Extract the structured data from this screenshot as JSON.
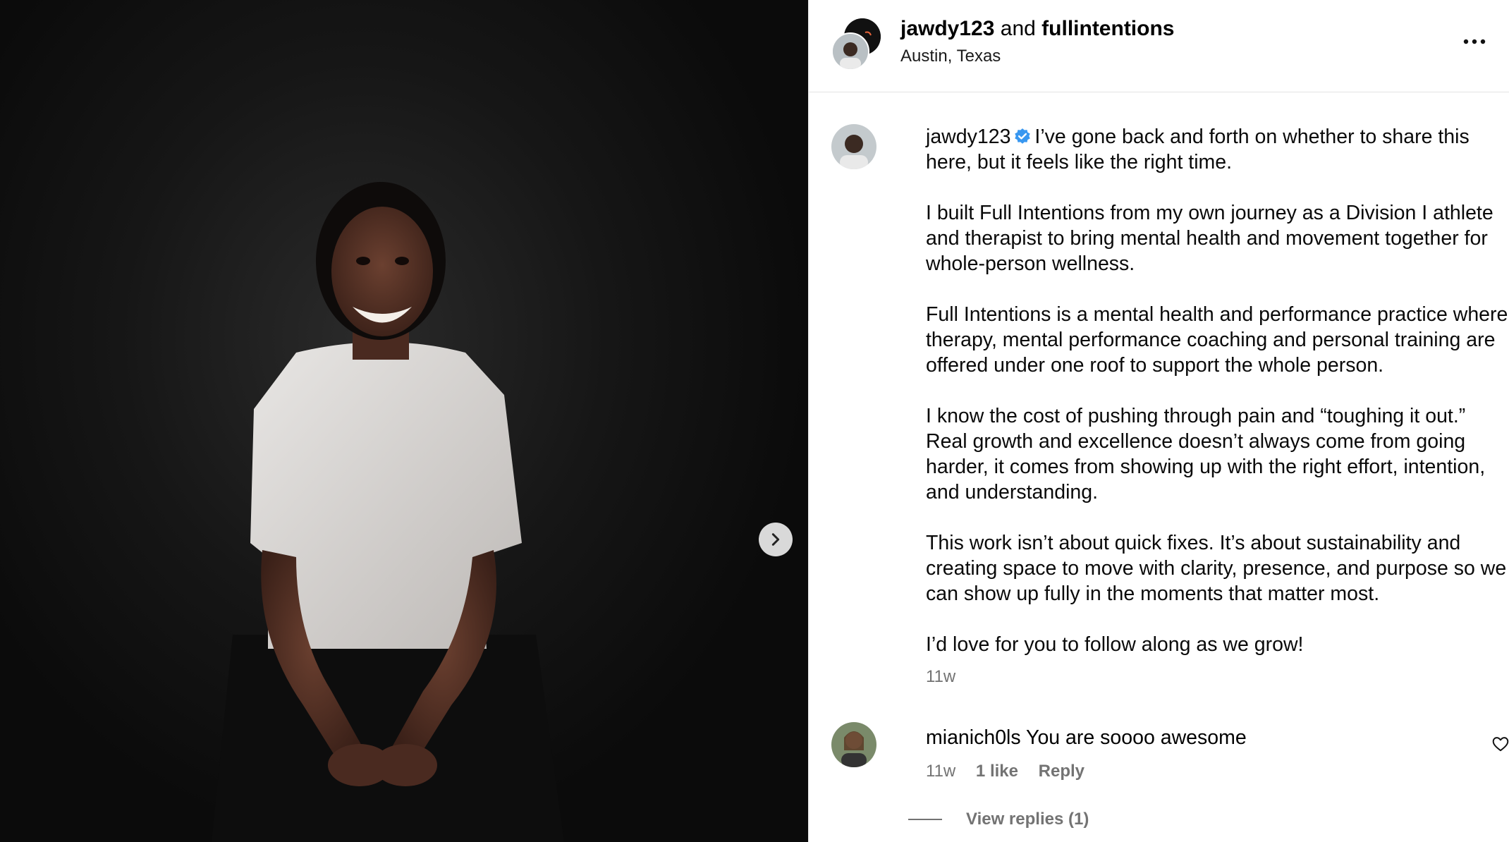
{
  "post": {
    "collab_user_1": "jawdy123",
    "collab_joiner": "and",
    "collab_user_2": "fullintentions",
    "location": "Austin, Texas"
  },
  "caption": {
    "username": "jawdy123",
    "paragraphs": [
      "I’ve gone back and forth on whether to share this here, but it feels like the right time.",
      "I built Full Intentions from my own journey as a Division I athlete and therapist to bring mental health and movement together for whole-person wellness.",
      "Full Intentions is a mental health and performance practice where therapy, mental performance coaching and personal training are offered under one roof to support the whole person.",
      "I know the cost of pushing through pain and “toughing it out.” Real growth and excellence doesn’t always come from going harder, it comes from showing up with the right effort, intention, and understanding.",
      "This work isn’t about quick fixes. It’s about sustainability and creating space to move with clarity, presence, and purpose so we can show up fully in the moments that matter most.",
      "I’d love for you to follow along as we grow!"
    ],
    "time": "11w"
  },
  "comment": {
    "username": "mianich0ls",
    "text": "You are soooo awesome",
    "time": "11w",
    "likes": "1 like",
    "reply_label": "Reply",
    "view_replies": "View replies (1)"
  },
  "icons": {
    "next": "chevron-right-icon",
    "more": "more-horizontal-icon",
    "verified": "verified-badge-icon",
    "like": "heart-icon"
  },
  "colors": {
    "verified_blue": "#3897f0",
    "secondary_text": "#737373",
    "divider": "#e3e3e3"
  }
}
